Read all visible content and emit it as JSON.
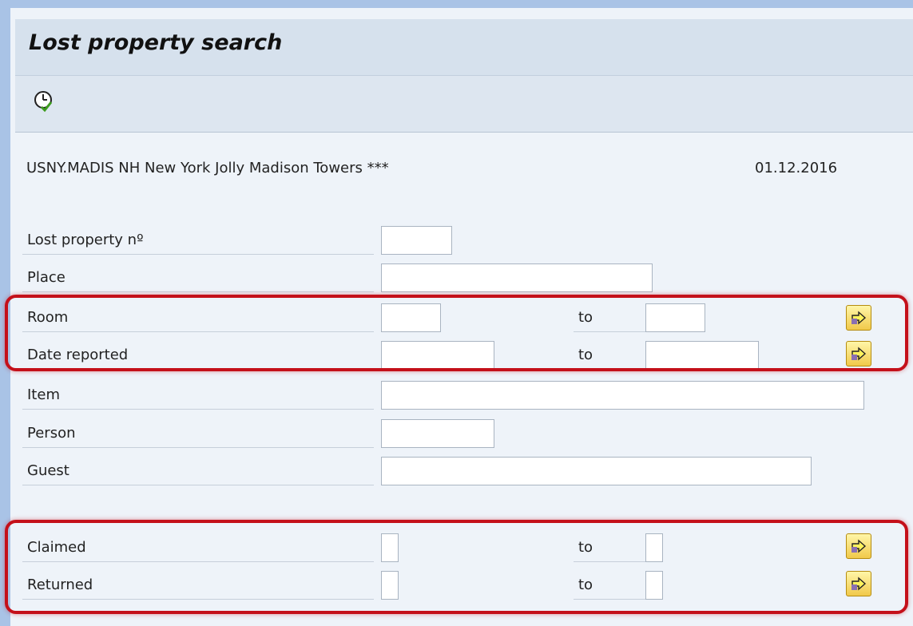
{
  "title": "Lost property search",
  "toolbar": {
    "execute_icon": "execute-clock-icon"
  },
  "header": {
    "hotel": "USNY.MADIS NH New York Jolly Madison Towers ***",
    "date": "01.12.2016"
  },
  "fields": {
    "lost_property_no": {
      "label": "Lost property nº",
      "value": ""
    },
    "place": {
      "label": "Place",
      "value": ""
    },
    "room": {
      "label": "Room",
      "from": "",
      "to_label": "to",
      "to": ""
    },
    "date_reported": {
      "label": "Date reported",
      "from": "",
      "to_label": "to",
      "to": ""
    },
    "item": {
      "label": "Item",
      "value": ""
    },
    "person": {
      "label": "Person",
      "value": ""
    },
    "guest": {
      "label": "Guest",
      "value": ""
    },
    "claimed": {
      "label": "Claimed",
      "from": "",
      "to_label": "to",
      "to": ""
    },
    "returned": {
      "label": "Returned",
      "from": "",
      "to_label": "to",
      "to": ""
    }
  },
  "colors": {
    "highlight": "#c4101a",
    "more_button": "#f1c94a",
    "title_bar": "#d6e1ed"
  }
}
